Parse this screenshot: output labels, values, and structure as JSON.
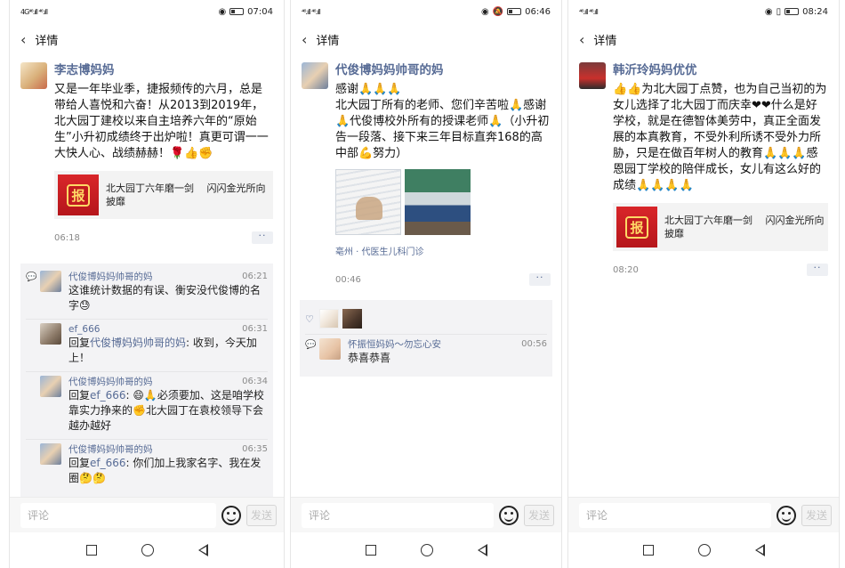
{
  "common": {
    "back_label": "详情",
    "comment_placeholder": "评论",
    "send_label": "发送",
    "more_label": "··"
  },
  "screens": [
    {
      "status": {
        "signal": "4G⁴⁶.ıll ⁴⁶.ıll",
        "time": "07:04"
      },
      "post": {
        "author": "李志博妈妈",
        "text": "又是一年毕业季，捷报频传的六月，总是带给人喜悦和六奋！从2013到2019年，北大园丁建校以来自主培养六年的“原始生”小升初成绩终于出炉啦！真更可谓一一大快人心、战绩赫赫！🌹👍✊",
        "share_title": "北大园丁六年磨一剑　 闪闪金光所向披靡",
        "share_icon": "报",
        "time": "06:18"
      },
      "comments": [
        {
          "name": "代俊博妈妈帅哥的妈",
          "time": "06:21",
          "prefix": "",
          "reply_to": "",
          "text": "这谁统计数据的有误、衡安没代俊博的名字😓"
        },
        {
          "name": "ef_666",
          "time": "06:31",
          "prefix": "回复",
          "reply_to": "代俊博妈妈帅哥的妈",
          "text": ": 收到，今天加上！"
        },
        {
          "name": "代俊博妈妈帅哥的妈",
          "time": "06:34",
          "prefix": "回复",
          "reply_to": "ef_666",
          "text": ": 😄🙏必须要加、这是咱学校靠实力挣来的✊北大园丁在袁校领导下会越办越好"
        },
        {
          "name": "代俊博妈妈帅哥的妈",
          "time": "06:35",
          "prefix": "回复",
          "reply_to": "ef_666",
          "text": ": 你们加上我家名字、我在发圈🤔🤔"
        }
      ]
    },
    {
      "status": {
        "signal": "⁴⁶.ıll ⁴⁶.ıll",
        "time": "06:46"
      },
      "post": {
        "author": "代俊博妈妈帅哥的妈",
        "text": "感谢🙏🙏🙏\n北大园丁所有的老师、您们辛苦啦🙏感谢🙏代俊博校外所有的授课老师🙏（小升初告一段落、接下来三年目标直奔168的高中部💪努力）",
        "location": "亳州 · 代医生儿科门诊",
        "time": "00:46"
      },
      "comments": [
        {
          "name": "怀振恒妈妈～勿忘心安",
          "time": "00:56",
          "prefix": "",
          "reply_to": "",
          "text": "恭喜恭喜"
        }
      ]
    },
    {
      "status": {
        "signal": "⁴⁶.ıll ⁴⁶.ıll",
        "time": "08:24"
      },
      "post": {
        "author": "韩沂玲妈妈优优",
        "text": "👍👍为北大园丁点赞，也为自己当初的为女儿选择了北大园丁而庆幸❤❤什么是好学校，就是在德智体美劳中，真正全面发展的本真教育，不受外利所诱不受外力所胁，只是在做百年树人的教育🙏🙏🙏感恩园丁学校的陪伴成长，女儿有这么好的成绩🙏🙏🙏🙏",
        "share_title": "北大园丁六年磨一剑　 闪闪金光所向披靡",
        "share_icon": "报",
        "time": "08:20"
      }
    }
  ]
}
